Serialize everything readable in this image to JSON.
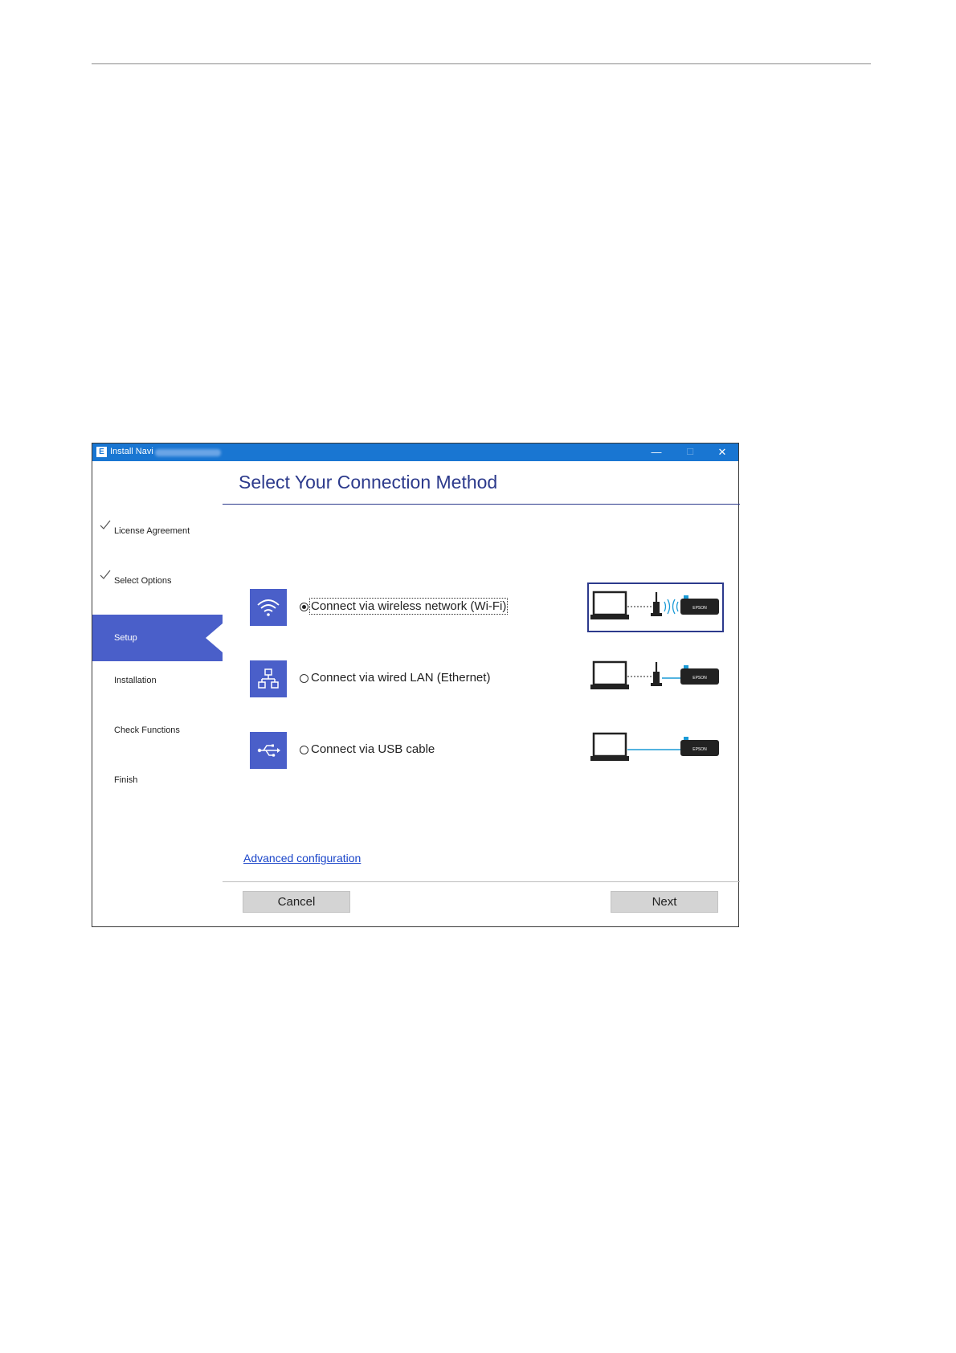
{
  "window": {
    "app_icon_letter": "E",
    "title": "Install Navi",
    "controls": {
      "minimize": "—",
      "maximize": "☐",
      "close": "✕"
    }
  },
  "sidebar": {
    "steps": [
      {
        "label": "License Agreement",
        "state": "done"
      },
      {
        "label": "Select Options",
        "state": "done"
      },
      {
        "label": "Setup",
        "state": "current"
      },
      {
        "label": "Installation",
        "state": "pending"
      },
      {
        "label": "Check Functions",
        "state": "pending"
      },
      {
        "label": "Finish",
        "state": "pending"
      }
    ]
  },
  "main": {
    "heading": "Select Your Connection Method",
    "options": [
      {
        "icon": "wifi-icon",
        "label": "Connect via wireless network (Wi-Fi)",
        "selected": true
      },
      {
        "icon": "network-icon",
        "label": "Connect via wired LAN (Ethernet)",
        "selected": false
      },
      {
        "icon": "usb-icon",
        "label": "Connect via USB cable",
        "selected": false
      }
    ],
    "printer_brand": "EPSON",
    "advanced_link": "Advanced configuration"
  },
  "footer": {
    "cancel_label": "Cancel",
    "next_label": "Next"
  },
  "colors": {
    "titlebar": "#1976d2",
    "accent": "#4a5fc9",
    "heading": "#2c3a8c",
    "link": "#1a45c9",
    "usb_cable": "#1a9ad6"
  }
}
